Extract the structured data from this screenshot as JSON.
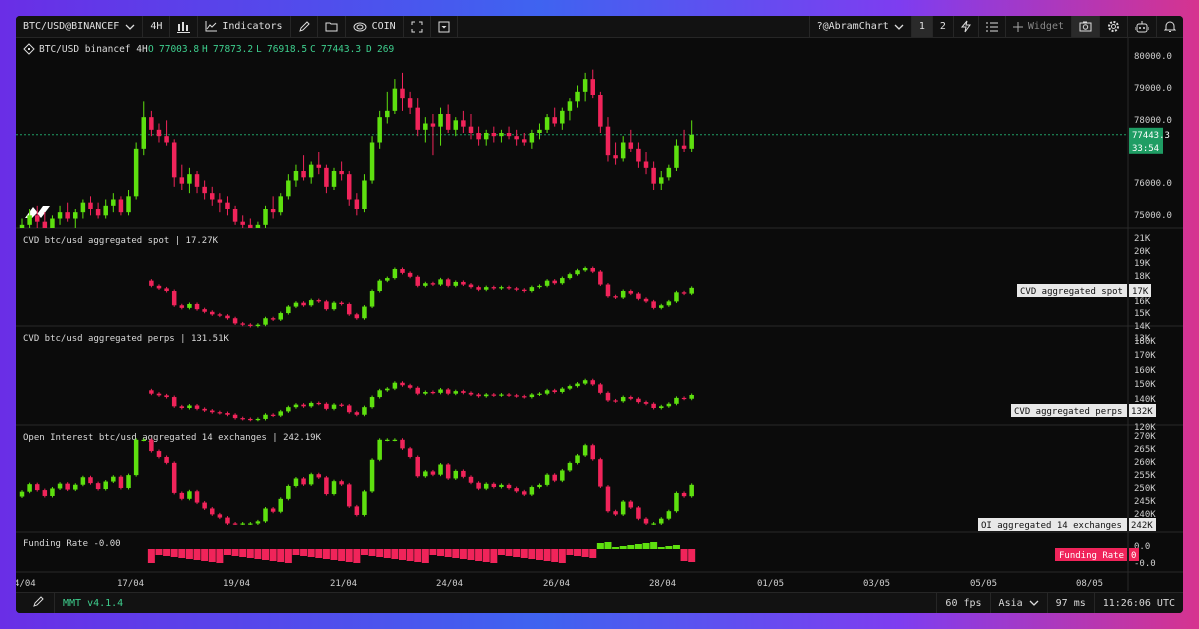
{
  "toolbar": {
    "symbol": "BTC/USD@BINANCEF",
    "timeframe": "4H",
    "indicators": "Indicators",
    "coin": "COIN",
    "user": "?@AbramChart",
    "layout1": "1",
    "layout2": "2",
    "widget": "Widget"
  },
  "legend": {
    "title": "BTC/USD binancef 4H",
    "o_label": "O",
    "o": "77003.8",
    "h_label": "H",
    "h": "77873.2",
    "l_label": "L",
    "l": "76918.5",
    "c_label": "C",
    "c": "77443.3",
    "d_label": "D",
    "d": "269"
  },
  "price_scale": [
    "80000.0",
    "79000.0",
    "78000.0",
    "76000.0",
    "75000.0"
  ],
  "last_price": "77443.3",
  "countdown": "33:54",
  "panes": {
    "spot": {
      "title": "CVD btc/usd aggregated spot | 17.27K",
      "scale": [
        "21K",
        "20K",
        "19K",
        "18K",
        "16K",
        "15K",
        "14K",
        "13K"
      ],
      "tag": "CVD aggregated spot",
      "value": "17K"
    },
    "perps": {
      "title": "CVD btc/usd aggregated perps | 131.51K",
      "scale": [
        "180K",
        "170K",
        "160K",
        "150K",
        "140K",
        "120K"
      ],
      "tag": "CVD aggregated perps",
      "value": "132K"
    },
    "oi": {
      "title": "Open Interest btc/usd aggregated 14 exchanges | 242.19K",
      "scale": [
        "270K",
        "265K",
        "260K",
        "255K",
        "250K",
        "245K",
        "240K",
        "235K"
      ],
      "tag": "OI aggregated 14 exchanges",
      "value": "242K"
    },
    "funding": {
      "title": "Funding Rate -0.00",
      "scale": [
        "0.0",
        "-0.0"
      ],
      "tag": "Funding Rate",
      "value": "0"
    }
  },
  "time_axis": [
    "4/04",
    "17/04",
    "19/04",
    "21/04",
    "24/04",
    "26/04",
    "28/04",
    "01/05",
    "03/05",
    "05/05",
    "08/05"
  ],
  "status": {
    "version": "MMT v4.1.4",
    "fps": "60 fps",
    "region": "Asia",
    "latency": "97 ms",
    "clock": "11:26:06 UTC"
  },
  "colors": {
    "up": "#5ee00f",
    "down": "#f0245a",
    "background": "#0b0b0b",
    "accent": "#1f9d64"
  },
  "chart_data": {
    "type": "candlestick",
    "title": "BTC/USD binancef 4H",
    "ylim": [
      74500,
      80500
    ],
    "ohlc": [
      [
        74400,
        74800,
        74200,
        74600
      ],
      [
        74600,
        75100,
        74400,
        74900
      ],
      [
        74900,
        75200,
        74500,
        74700
      ],
      [
        74700,
        75000,
        74300,
        74500
      ],
      [
        74500,
        74900,
        74300,
        74800
      ],
      [
        74800,
        75200,
        74600,
        75000
      ],
      [
        75000,
        75300,
        74700,
        74800
      ],
      [
        74800,
        75100,
        74500,
        75000
      ],
      [
        75000,
        75400,
        74800,
        75300
      ],
      [
        75300,
        75500,
        74900,
        75100
      ],
      [
        75100,
        75300,
        74800,
        74900
      ],
      [
        74900,
        75400,
        74800,
        75200
      ],
      [
        75200,
        75600,
        75000,
        75400
      ],
      [
        75400,
        75500,
        74900,
        75000
      ],
      [
        75000,
        75700,
        74900,
        75500
      ],
      [
        75500,
        77200,
        75400,
        77000
      ],
      [
        77000,
        78500,
        76800,
        78000
      ],
      [
        78000,
        78200,
        77400,
        77600
      ],
      [
        77600,
        77800,
        77200,
        77400
      ],
      [
        77400,
        77900,
        77100,
        77200
      ],
      [
        77200,
        77300,
        75800,
        76100
      ],
      [
        76100,
        76500,
        75700,
        75900
      ],
      [
        75900,
        76400,
        75600,
        76200
      ],
      [
        76200,
        76300,
        75600,
        75800
      ],
      [
        75800,
        76000,
        75400,
        75600
      ],
      [
        75600,
        75800,
        75200,
        75400
      ],
      [
        75400,
        75600,
        75000,
        75300
      ],
      [
        75300,
        75500,
        74900,
        75100
      ],
      [
        75100,
        75200,
        74600,
        74700
      ],
      [
        74700,
        74900,
        74400,
        74600
      ],
      [
        74600,
        74800,
        74300,
        74500
      ],
      [
        74500,
        74700,
        74300,
        74600
      ],
      [
        74600,
        75200,
        74500,
        75100
      ],
      [
        75100,
        75500,
        74800,
        75000
      ],
      [
        75000,
        75600,
        74900,
        75500
      ],
      [
        75500,
        76200,
        75400,
        76000
      ],
      [
        76000,
        76500,
        75800,
        76300
      ],
      [
        76300,
        76800,
        76000,
        76100
      ],
      [
        76100,
        76600,
        75900,
        76500
      ],
      [
        76500,
        76900,
        76200,
        76400
      ],
      [
        76400,
        76500,
        75600,
        75800
      ],
      [
        75800,
        76400,
        75700,
        76300
      ],
      [
        76300,
        76600,
        76000,
        76200
      ],
      [
        76200,
        76300,
        75200,
        75400
      ],
      [
        75400,
        75600,
        74900,
        75100
      ],
      [
        75100,
        76200,
        75000,
        76000
      ],
      [
        76000,
        77400,
        75900,
        77200
      ],
      [
        77200,
        78200,
        77000,
        78000
      ],
      [
        78000,
        78800,
        77800,
        78200
      ],
      [
        78200,
        79200,
        78100,
        78900
      ],
      [
        78900,
        79400,
        78200,
        78600
      ],
      [
        78600,
        78800,
        78100,
        78300
      ],
      [
        78300,
        78600,
        77400,
        77600
      ],
      [
        77600,
        78000,
        77200,
        77800
      ],
      [
        77800,
        78100,
        76800,
        77700
      ],
      [
        77700,
        78300,
        77100,
        78100
      ],
      [
        78100,
        78400,
        77500,
        77600
      ],
      [
        77600,
        78000,
        77400,
        77900
      ],
      [
        77900,
        78200,
        77500,
        77700
      ],
      [
        77700,
        78100,
        77300,
        77500
      ],
      [
        77500,
        77700,
        77100,
        77300
      ],
      [
        77300,
        77600,
        77100,
        77500
      ],
      [
        77500,
        77700,
        77200,
        77400
      ],
      [
        77400,
        77600,
        77200,
        77500
      ],
      [
        77500,
        77700,
        77300,
        77400
      ],
      [
        77400,
        77600,
        77100,
        77300
      ],
      [
        77300,
        77500,
        77100,
        77200
      ],
      [
        77200,
        77600,
        77000,
        77500
      ],
      [
        77500,
        77800,
        77300,
        77600
      ],
      [
        77600,
        78100,
        77500,
        78000
      ],
      [
        78000,
        78300,
        77700,
        77800
      ],
      [
        77800,
        78300,
        77600,
        78200
      ],
      [
        78200,
        78600,
        77900,
        78500
      ],
      [
        78500,
        79000,
        78300,
        78800
      ],
      [
        78800,
        79400,
        78500,
        79200
      ],
      [
        79200,
        79500,
        78600,
        78700
      ],
      [
        78700,
        78800,
        77500,
        77700
      ],
      [
        77700,
        78000,
        76600,
        76800
      ],
      [
        76800,
        77200,
        76500,
        76700
      ],
      [
        76700,
        77400,
        76600,
        77200
      ],
      [
        77200,
        77600,
        76900,
        77000
      ],
      [
        77000,
        77200,
        76400,
        76600
      ],
      [
        76600,
        76900,
        76200,
        76400
      ],
      [
        76400,
        76600,
        75700,
        75900
      ],
      [
        75900,
        76300,
        75700,
        76100
      ],
      [
        76100,
        76500,
        76000,
        76400
      ],
      [
        76400,
        77300,
        76300,
        77100
      ],
      [
        77100,
        77600,
        76900,
        77000
      ],
      [
        77000,
        77900,
        76900,
        77443
      ]
    ]
  }
}
